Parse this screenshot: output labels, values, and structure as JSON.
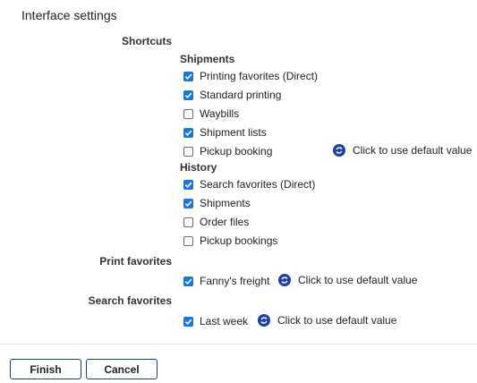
{
  "page": {
    "title": "Interface settings"
  },
  "shortcuts": {
    "label": "Shortcuts",
    "shipments": {
      "label": "Shipments",
      "items": [
        {
          "label": "Printing favorites (Direct)",
          "checked": true
        },
        {
          "label": "Standard printing",
          "checked": true
        },
        {
          "label": "Waybills",
          "checked": false
        },
        {
          "label": "Shipment lists",
          "checked": true
        },
        {
          "label": "Pickup booking",
          "checked": false
        }
      ]
    },
    "history": {
      "label": "History",
      "items": [
        {
          "label": "Search favorites (Direct)",
          "checked": true
        },
        {
          "label": "Shipments",
          "checked": true
        },
        {
          "label": "Order files",
          "checked": false
        },
        {
          "label": "Pickup bookings",
          "checked": false
        }
      ]
    },
    "default_link_label": "Click to use default value"
  },
  "print_favorites": {
    "label": "Print favorites",
    "item": {
      "label": "Fanny's freight",
      "checked": true
    },
    "default_link_label": "Click to use default value"
  },
  "search_favorites": {
    "label": "Search favorites",
    "item": {
      "label": "Last week",
      "checked": true
    },
    "default_link_label": "Click to use default value"
  },
  "footer": {
    "finish_label": "Finish",
    "cancel_label": "Cancel"
  },
  "colors": {
    "checkbox_checked": "#1a73e8",
    "reset_icon": "#1c3fa8",
    "button_border": "#1f3d7a"
  },
  "icons": {
    "reset": "reset-icon",
    "check": "checkmark-icon"
  }
}
